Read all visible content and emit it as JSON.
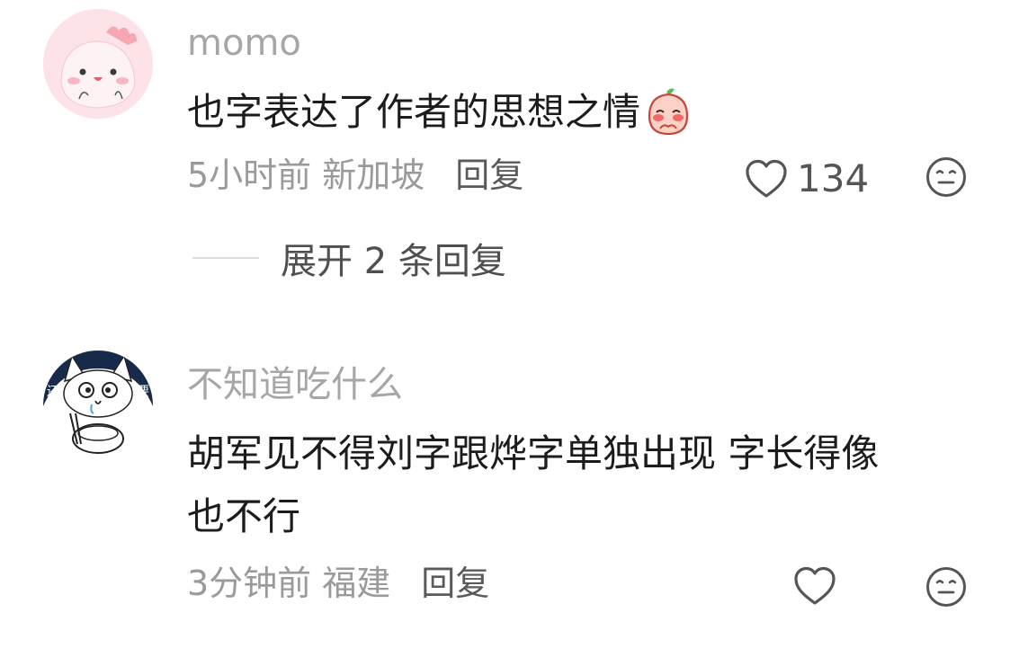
{
  "comments": [
    {
      "username": "momo",
      "content": "也字表达了作者的思想之情",
      "time": "5小时前",
      "location": "新加坡",
      "reply_label": "回复",
      "like_count": "134",
      "expand_label": "展开 2 条回复"
    },
    {
      "username": "不知道吃什么",
      "content_line1": "胡军见不得刘字跟烨字单独出现 字长得像",
      "content_line2": "也不行",
      "time": "3分钟前",
      "location": "福建",
      "reply_label": "回复",
      "like_count": ""
    }
  ],
  "icons": {
    "like": "heart-outline-icon",
    "dislike": "neutral-face-icon",
    "inline_emoji": "blushing-peach-emoji"
  },
  "colors": {
    "background": "#ffffff",
    "username": "#a6a6a6",
    "content": "#1c1c1c",
    "meta": "#9a9a9a",
    "reply": "#5a5a5a",
    "avatar1_bg": "#fde3e7",
    "avatar2_bg": "#ffffff"
  },
  "avatar2_text": {
    "left": "还",
    "right": "要"
  }
}
